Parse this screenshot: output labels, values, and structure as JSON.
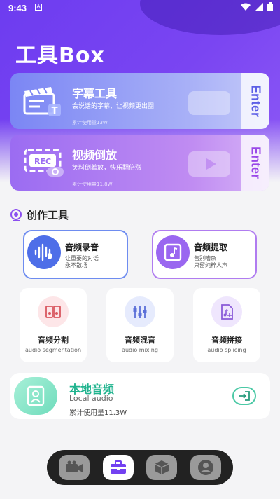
{
  "status_bar": {
    "time": "9:43",
    "indicator": "A"
  },
  "app": {
    "title": "工具Box"
  },
  "feature_cards": [
    {
      "title": "字幕工具",
      "desc": "会说话的字幕，让视频更出圈",
      "usage": "累计使用量13W",
      "enter_label": "Enter",
      "icon": "clapperboard-icon"
    },
    {
      "title": "视频倒放",
      "desc": "笑料倒着放，快乐翻倍涨",
      "usage": "累计使用量11.8W",
      "enter_label": "Enter",
      "icon": "rec-icon"
    }
  ],
  "section": {
    "title": "创作工具"
  },
  "tools": [
    {
      "title": "音频录音",
      "desc_line1": "让重要的对话",
      "desc_line2": "永不散场",
      "icon": "microphone-waveform-icon"
    },
    {
      "title": "音频提取",
      "desc_line1": "告别嘈杂",
      "desc_line2": "只留纯粹人声",
      "icon": "music-note-icon"
    }
  ],
  "mini_tools": [
    {
      "title": "音频分割",
      "subtitle": "audio segmentation",
      "icon": "split-audio-icon"
    },
    {
      "title": "音频混音",
      "subtitle": "audio mixing",
      "icon": "mixer-icon"
    },
    {
      "title": "音频拼接",
      "subtitle": "audio splicing",
      "icon": "splice-file-icon"
    }
  ],
  "local_audio": {
    "title": "本地音频",
    "subtitle": "Local audio",
    "usage": "累计使用量11.3W"
  },
  "nav": [
    {
      "icon": "video-camera-icon",
      "active": false
    },
    {
      "icon": "toolbox-icon",
      "active": true
    },
    {
      "icon": "cube-icon",
      "active": false
    },
    {
      "icon": "profile-icon",
      "active": false
    }
  ],
  "colors": {
    "primary": "#7341f1",
    "record_accent": "#4e6ee8",
    "extract_accent": "#9a67f0",
    "local_accent": "#1fb38e"
  }
}
